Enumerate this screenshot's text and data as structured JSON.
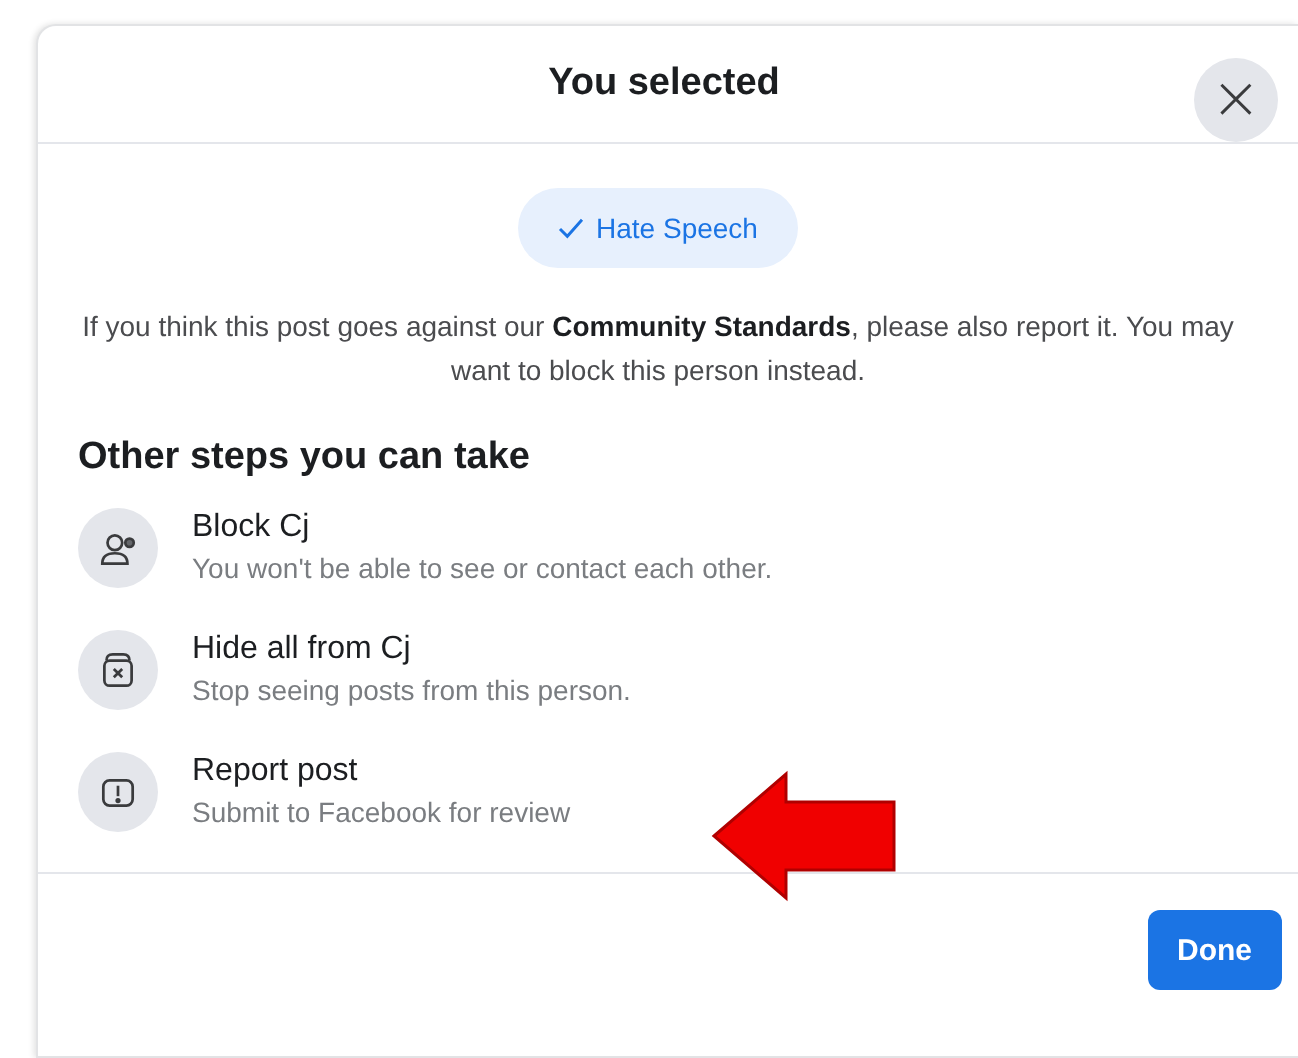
{
  "dialog": {
    "title": "You selected",
    "close_icon": "×"
  },
  "selected_chip": {
    "label": "Hate Speech",
    "selected": true
  },
  "notice": "If you think this post goes against our **Community Standards**, please also report it. You may want to block this person instead.",
  "section_heading": "Other steps you can take",
  "options": [
    {
      "kind": "block",
      "title": "Block Cj",
      "subtitle": "You won't be able to see or contact each other."
    },
    {
      "kind": "hide",
      "title": "Hide all from Cj",
      "subtitle": "Stop seeing posts from this person."
    },
    {
      "kind": "report",
      "title": "Report post",
      "subtitle": "Submit to Facebook for review"
    }
  ],
  "buttons": [
    "Done"
  ]
}
